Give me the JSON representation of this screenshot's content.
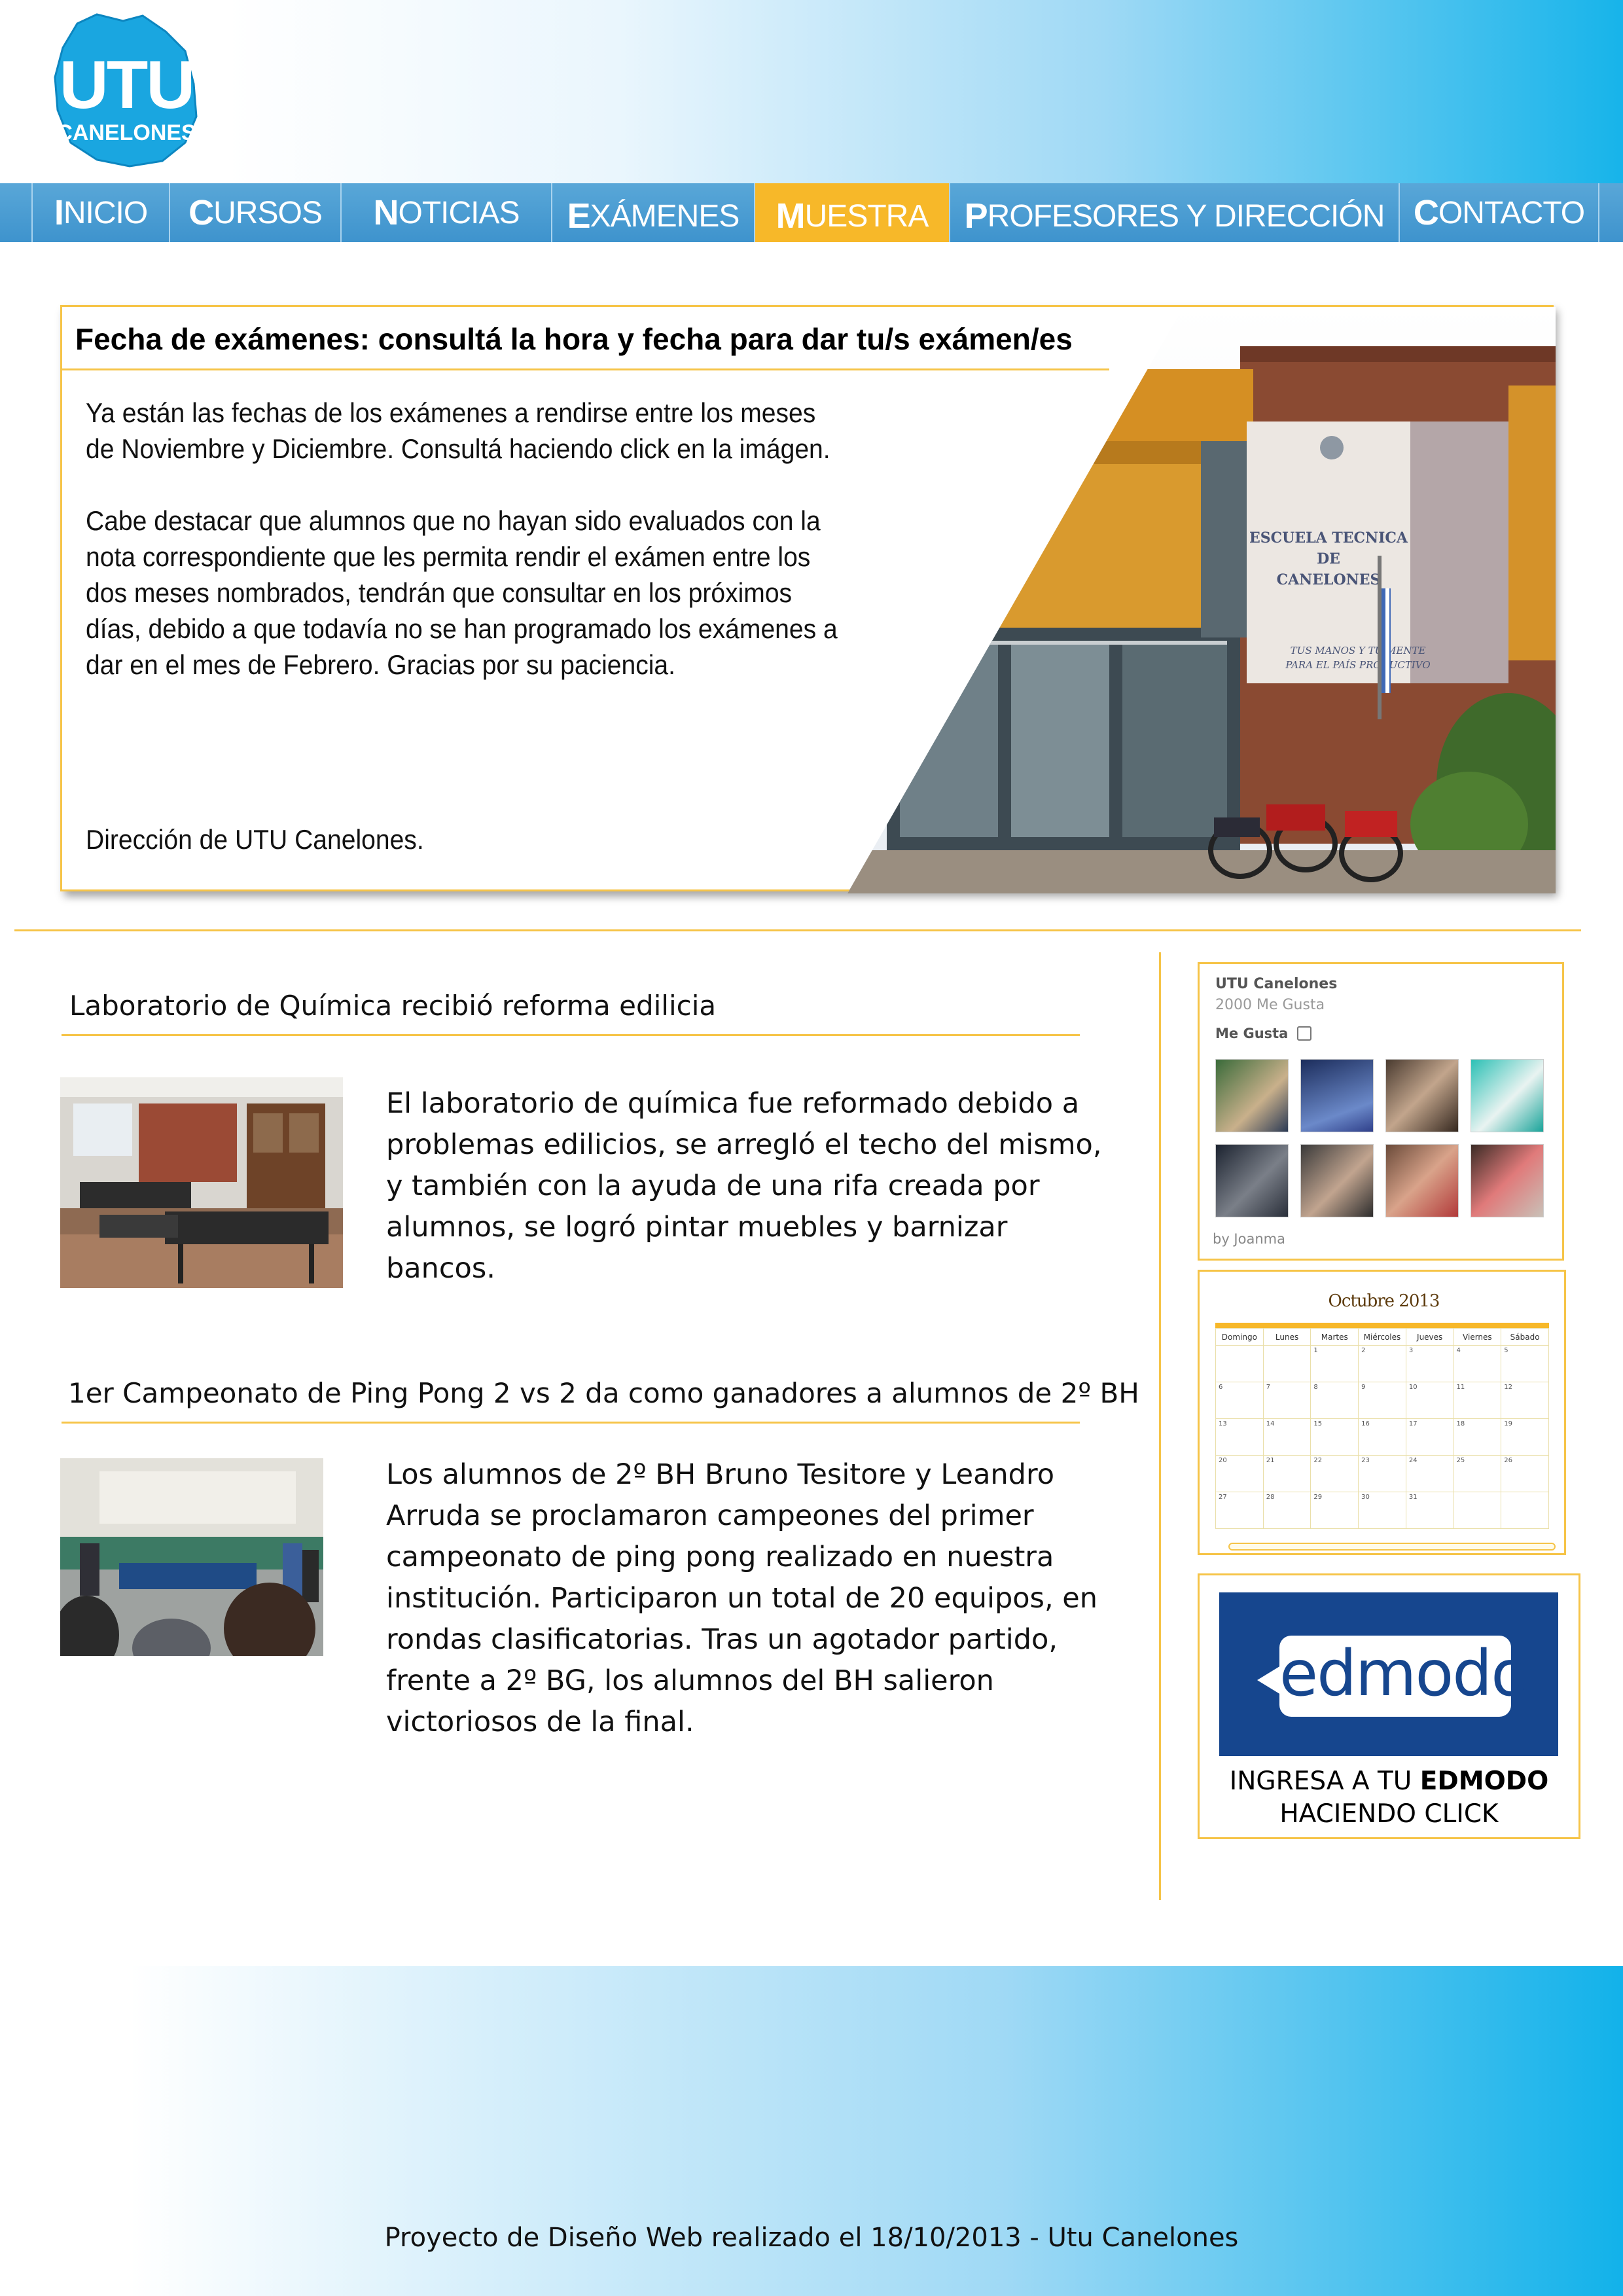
{
  "header": {
    "logo_main": "UTU",
    "logo_sub": "CANELONES"
  },
  "nav": {
    "items": [
      {
        "first": "I",
        "rest": "NICIO",
        "active": false
      },
      {
        "first": "C",
        "rest": "URSOS",
        "active": false
      },
      {
        "first": "N",
        "rest": "OTICIAS",
        "active": false
      },
      {
        "first": "E",
        "rest": "XÁMENES",
        "active": false
      },
      {
        "first": "M",
        "rest": "UESTRA",
        "active": true
      },
      {
        "first": "P",
        "rest": "ROFESORES Y DIRECCIÓN",
        "active": false
      },
      {
        "first": "C",
        "rest": "ONTACTO",
        "active": false
      }
    ]
  },
  "feature": {
    "title": "Fecha de exámenes: consultá la hora y fecha para dar tu/s exámen/es",
    "paragraph1": "Ya están las fechas de los exámenes a rendirse entre los meses de Noviembre y Diciembre. Consultá haciendo click en la imágen.",
    "paragraph2": "Cabe destacar que alumnos que no hayan sido evaluados con la nota correspondiente que les permita rendir el exámen entre los dos meses nombrados, tendrán que consultar en los próximos días, debido a que todavía no se han programado los exámenes a dar en el mes de Febrero. Gracias por su paciencia.",
    "signature": "Dirección de UTU Canelones.",
    "photo": {
      "banner_line1": "ESCUELA TECNICA",
      "banner_line2": "DE",
      "banner_line3": "CANELONES",
      "banner_slogan1": "TUS MANOS Y TU MENTE",
      "banner_slogan2": "PARA EL PAÍS PRODUCTIVO"
    }
  },
  "news": [
    {
      "title": "Laboratorio de Química recibió reforma edilicia",
      "body": "El laboratorio de química fue reformado debido a problemas edilicios, se arregló el techo del mismo, y también con la ayuda de una rifa creada por alumnos, se logró pintar muebles y barnizar bancos."
    },
    {
      "title": "1er Campeonato de Ping Pong 2 vs 2 da como ganadores a alumnos de 2º BH",
      "body": "Los alumnos de 2º BH Bruno Tesitore y Leandro Arruda se proclamaron campeones del primer campeonato de ping pong realizado en nuestra institución. Participaron un total de 20 equipos, en rondas clasificatorias. Tras un agotador partido, frente a 2º BG, los alumnos del BH salieron victoriosos de la final."
    }
  ],
  "facebook": {
    "page_name": "UTU Canelones",
    "likes": "2000 Me Gusta",
    "like_button": "Me Gusta",
    "credit": "by Joanma"
  },
  "calendar": {
    "title": "Octubre 2013",
    "days": [
      "Domingo",
      "Lunes",
      "Martes",
      "Miércoles",
      "Jueves",
      "Viernes",
      "Sábado"
    ],
    "weeks": [
      [
        "",
        "",
        "1",
        "2",
        "3",
        "4",
        "5"
      ],
      [
        "6",
        "7",
        "8",
        "9",
        "10",
        "11",
        "12"
      ],
      [
        "13",
        "14",
        "15",
        "16",
        "17",
        "18",
        "19"
      ],
      [
        "20",
        "21",
        "22",
        "23",
        "24",
        "25",
        "26"
      ],
      [
        "27",
        "28",
        "29",
        "30",
        "31",
        "",
        ""
      ]
    ]
  },
  "edmodo": {
    "logo_word": "edmodo",
    "cta_prefix": "INGRESA A TU ",
    "cta_bold": "EDMODO",
    "cta_line2": "HACIENDO CLICK"
  },
  "footer": {
    "text": "Proyecto de Diseño Web realizado el 18/10/2013 - Utu Canelones"
  },
  "colors": {
    "accent_orange": "#f6c448",
    "nav_blue": "#3e93cd",
    "nav_active": "#f7b829",
    "edmodo_blue": "#16468e"
  }
}
